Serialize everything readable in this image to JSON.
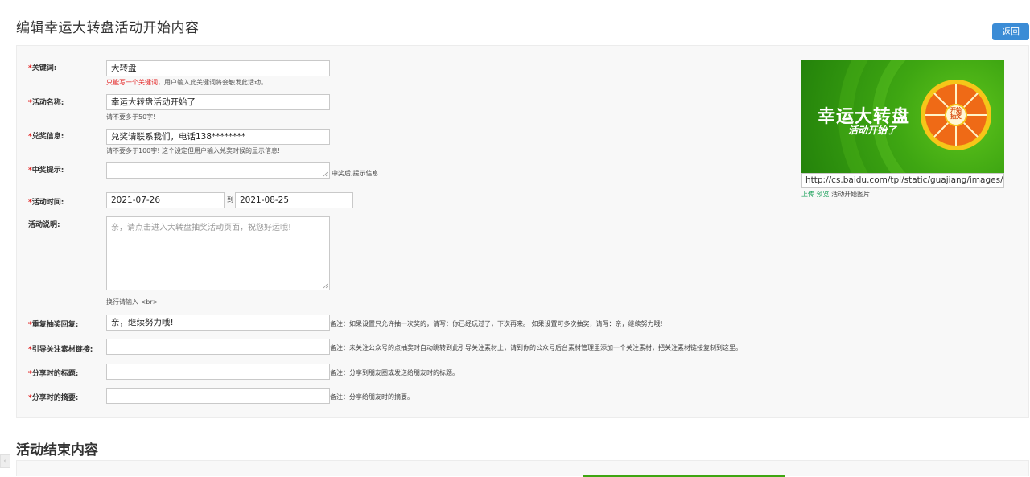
{
  "page": {
    "title": "编辑幸运大转盘活动开始内容",
    "back_label": "返回",
    "section2_title": "活动结束内容"
  },
  "form": {
    "keyword": {
      "label": "关键词:",
      "value": "大转盘",
      "hint_red": "只能写一个关键词",
      "hint_rest": "，用户输入此关键词将会触发此活动。"
    },
    "activity_name": {
      "label": "活动名称:",
      "value": "幸运大转盘活动开始了",
      "hint": "请不要多于50字!"
    },
    "redeem_info": {
      "label": "兑奖信息:",
      "value": "兑奖请联系我们，电话138********",
      "hint": "请不要多于100字! 这个设定但用户输入兑奖时候的显示信息!"
    },
    "win_tip": {
      "label": "中奖提示:",
      "value": "",
      "note": "中奖后,提示信息"
    },
    "activity_time": {
      "label": "活动时间:",
      "start": "2021-07-26",
      "to": "到",
      "end": "2021-08-25"
    },
    "description": {
      "label": "活动说明:",
      "placeholder": "亲，请点击进入大转盘抽奖活动页面，祝您好运哦!",
      "hint": "换行请输入 <br>"
    },
    "repeat_reply": {
      "label": "重复抽奖回复:",
      "value": "亲，继续努力哦!",
      "note": "备注：如果设置只允许抽一次奖的，请写：你已经玩过了，下次再来。 如果设置可多次抽奖，请写：亲，继续努力哦!"
    },
    "follow_link": {
      "label": "引导关注素材链接:",
      "value": "",
      "note": "备注：未关注公众号的点抽奖时自动跳转到此引导关注素材上，请到你的公众号后台素材管理里添加一个关注素材，把关注素材链接复制到这里。"
    },
    "share_title": {
      "label": "分享时的标题:",
      "value": "",
      "note": "备注：分享到朋友圈或发送给朋友时的标题。"
    },
    "share_summary": {
      "label": "分享时的摘要:",
      "value": "",
      "note": "备注：分享给朋友时的摘要。"
    },
    "required_mark": "*"
  },
  "image": {
    "banner_title": "幸运大转盘",
    "banner_subtitle": "活动开始了",
    "wheel_center": "开始抽奖",
    "url": "http://cs.baidu.com/tpl/static/guajiang/images/act",
    "upload_label": "上传",
    "preview_label": "预览",
    "caption": "活动开始图片"
  },
  "colors": {
    "accent_blue": "#3b8cd6",
    "required_red": "#e32020",
    "banner_green": "#3ea612",
    "link_green": "#1aa05a"
  }
}
